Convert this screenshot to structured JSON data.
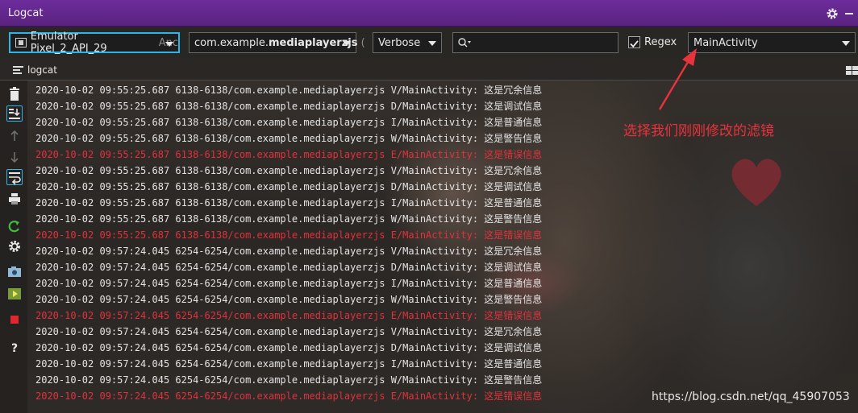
{
  "window": {
    "title": "Logcat"
  },
  "toolbar": {
    "device_name": "Emulator Pixel_2_API_29",
    "device_suffix": "Anc",
    "package_prefix": "com.example.",
    "package_bold": "mediaplayerzjs",
    "package_suffix": "(",
    "log_level": "Verbose",
    "search_value": "",
    "regex_checked": true,
    "regex_label": "Regex",
    "filter_config": "MainActivity"
  },
  "subtoolbar": {
    "label": "logcat"
  },
  "sidebar": {
    "buttons": [
      "trash-icon",
      "scroll-to-end-icon",
      "up-arrow-icon",
      "down-arrow-icon",
      "soft-wrap-icon",
      "print-icon",
      "restart-icon",
      "settings-icon",
      "screenshot-icon",
      "screen-record-icon",
      "stop-icon",
      "help-icon"
    ]
  },
  "log_lines": [
    {
      "text": "2020-10-02 09:55:25.687 6138-6138/com.example.mediaplayerzjs V/MainActivity: 这是冗余信息",
      "level": "V"
    },
    {
      "text": "2020-10-02 09:55:25.687 6138-6138/com.example.mediaplayerzjs D/MainActivity: 这是调试信息",
      "level": "D"
    },
    {
      "text": "2020-10-02 09:55:25.687 6138-6138/com.example.mediaplayerzjs I/MainActivity: 这是普通信息",
      "level": "I"
    },
    {
      "text": "2020-10-02 09:55:25.687 6138-6138/com.example.mediaplayerzjs W/MainActivity: 这是警告信息",
      "level": "W"
    },
    {
      "text": "2020-10-02 09:55:25.687 6138-6138/com.example.mediaplayerzjs E/MainActivity: 这是错误信息",
      "level": "E"
    },
    {
      "text": "2020-10-02 09:55:25.687 6138-6138/com.example.mediaplayerzjs V/MainActivity: 这是冗余信息",
      "level": "V"
    },
    {
      "text": "2020-10-02 09:55:25.687 6138-6138/com.example.mediaplayerzjs D/MainActivity: 这是调试信息",
      "level": "D"
    },
    {
      "text": "2020-10-02 09:55:25.687 6138-6138/com.example.mediaplayerzjs I/MainActivity: 这是普通信息",
      "level": "I"
    },
    {
      "text": "2020-10-02 09:55:25.687 6138-6138/com.example.mediaplayerzjs W/MainActivity: 这是警告信息",
      "level": "W"
    },
    {
      "text": "2020-10-02 09:55:25.687 6138-6138/com.example.mediaplayerzjs E/MainActivity: 这是错误信息",
      "level": "E"
    },
    {
      "text": "2020-10-02 09:57:24.045 6254-6254/com.example.mediaplayerzjs V/MainActivity: 这是冗余信息",
      "level": "V"
    },
    {
      "text": "2020-10-02 09:57:24.045 6254-6254/com.example.mediaplayerzjs D/MainActivity: 这是调试信息",
      "level": "D"
    },
    {
      "text": "2020-10-02 09:57:24.045 6254-6254/com.example.mediaplayerzjs I/MainActivity: 这是普通信息",
      "level": "I"
    },
    {
      "text": "2020-10-02 09:57:24.045 6254-6254/com.example.mediaplayerzjs W/MainActivity: 这是警告信息",
      "level": "W"
    },
    {
      "text": "2020-10-02 09:57:24.045 6254-6254/com.example.mediaplayerzjs E/MainActivity: 这是错误信息",
      "level": "E"
    },
    {
      "text": "2020-10-02 09:57:24.045 6254-6254/com.example.mediaplayerzjs V/MainActivity: 这是冗余信息",
      "level": "V"
    },
    {
      "text": "2020-10-02 09:57:24.045 6254-6254/com.example.mediaplayerzjs D/MainActivity: 这是调试信息",
      "level": "D"
    },
    {
      "text": "2020-10-02 09:57:24.045 6254-6254/com.example.mediaplayerzjs I/MainActivity: 这是普通信息",
      "level": "I"
    },
    {
      "text": "2020-10-02 09:57:24.045 6254-6254/com.example.mediaplayerzjs W/MainActivity: 这是警告信息",
      "level": "W"
    },
    {
      "text": "2020-10-02 09:57:24.045 6254-6254/com.example.mediaplayerzjs E/MainActivity: 这是错误信息",
      "level": "E"
    }
  ],
  "annotation": {
    "text": "选择我们刚刚修改的滤镜"
  },
  "watermark": {
    "text": "https://blog.csdn.net/qq_45907053"
  },
  "colors": {
    "title_bar": "#5b237f",
    "focus_border": "#2bb5e8",
    "error_text": "#e0323c",
    "annotation": "#e8323c"
  }
}
